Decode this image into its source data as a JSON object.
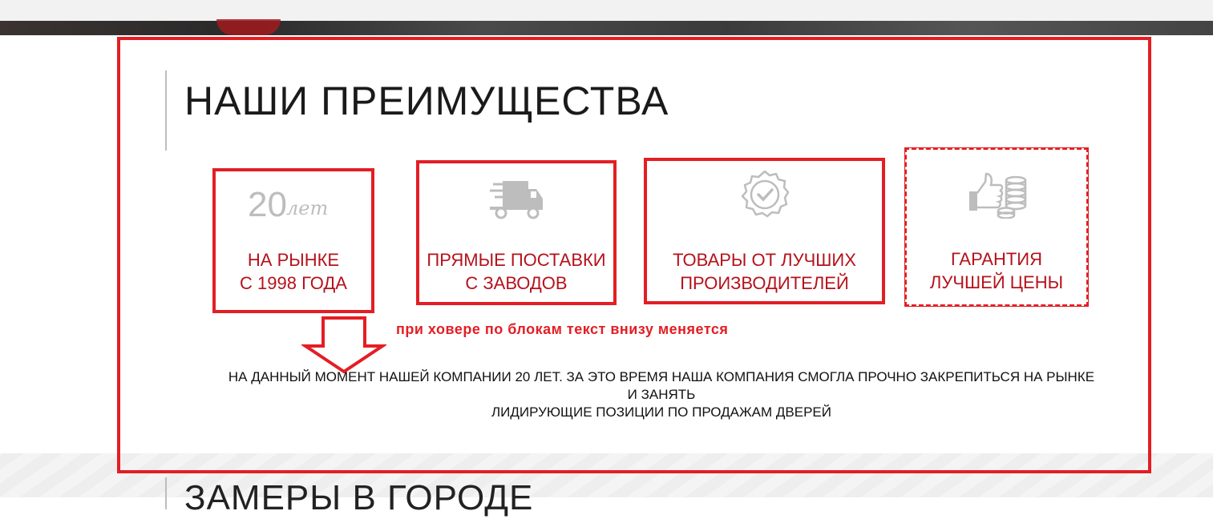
{
  "section": {
    "heading": "НАШИ ПРЕИМУЩЕСТВА",
    "next_heading": "ЗАМЕРЫ В ГОРОДЕ"
  },
  "cards": [
    {
      "line1": "НА РЫНКЕ",
      "line2": "С 1998 ГОДА",
      "icon": "years-icon",
      "icon_number": "20",
      "icon_word": "лет"
    },
    {
      "line1": "ПРЯМЫЕ ПОСТАВКИ",
      "line2": "С ЗАВОДОВ",
      "icon": "delivery-truck-icon"
    },
    {
      "line1": "ТОВАРЫ ОТ ЛУЧШИХ",
      "line2": "ПРОИЗВОДИТЕЛЕЙ",
      "icon": "quality-badge-icon"
    },
    {
      "line1": "ГАРАНТИЯ",
      "line2": "ЛУЧШЕЙ ЦЕНЫ",
      "icon": "thumbs-up-coins-icon"
    }
  ],
  "annotation": {
    "hover_note": "при ховере по блокам текст внизу меняется"
  },
  "description": {
    "line1": "НА ДАННЫЙ МОМЕНТ НАШЕЙ КОМПАНИИ 20 ЛЕТ. ЗА ЭТО ВРЕМЯ НАША КОМПАНИЯ СМОГЛА ПРОЧНО ЗАКРЕПИТЬСЯ НА РЫНКЕ И ЗАНЯТЬ",
    "line2": "ЛИДИРУЮЩИЕ ПОЗИЦИИ ПО ПРОДАЖАМ ДВЕРЕЙ"
  },
  "colors": {
    "accent_red": "#e31e24",
    "label_red": "#b5121b",
    "icon_gray": "#bdbdbd",
    "heading_text": "#1a1a1a"
  }
}
